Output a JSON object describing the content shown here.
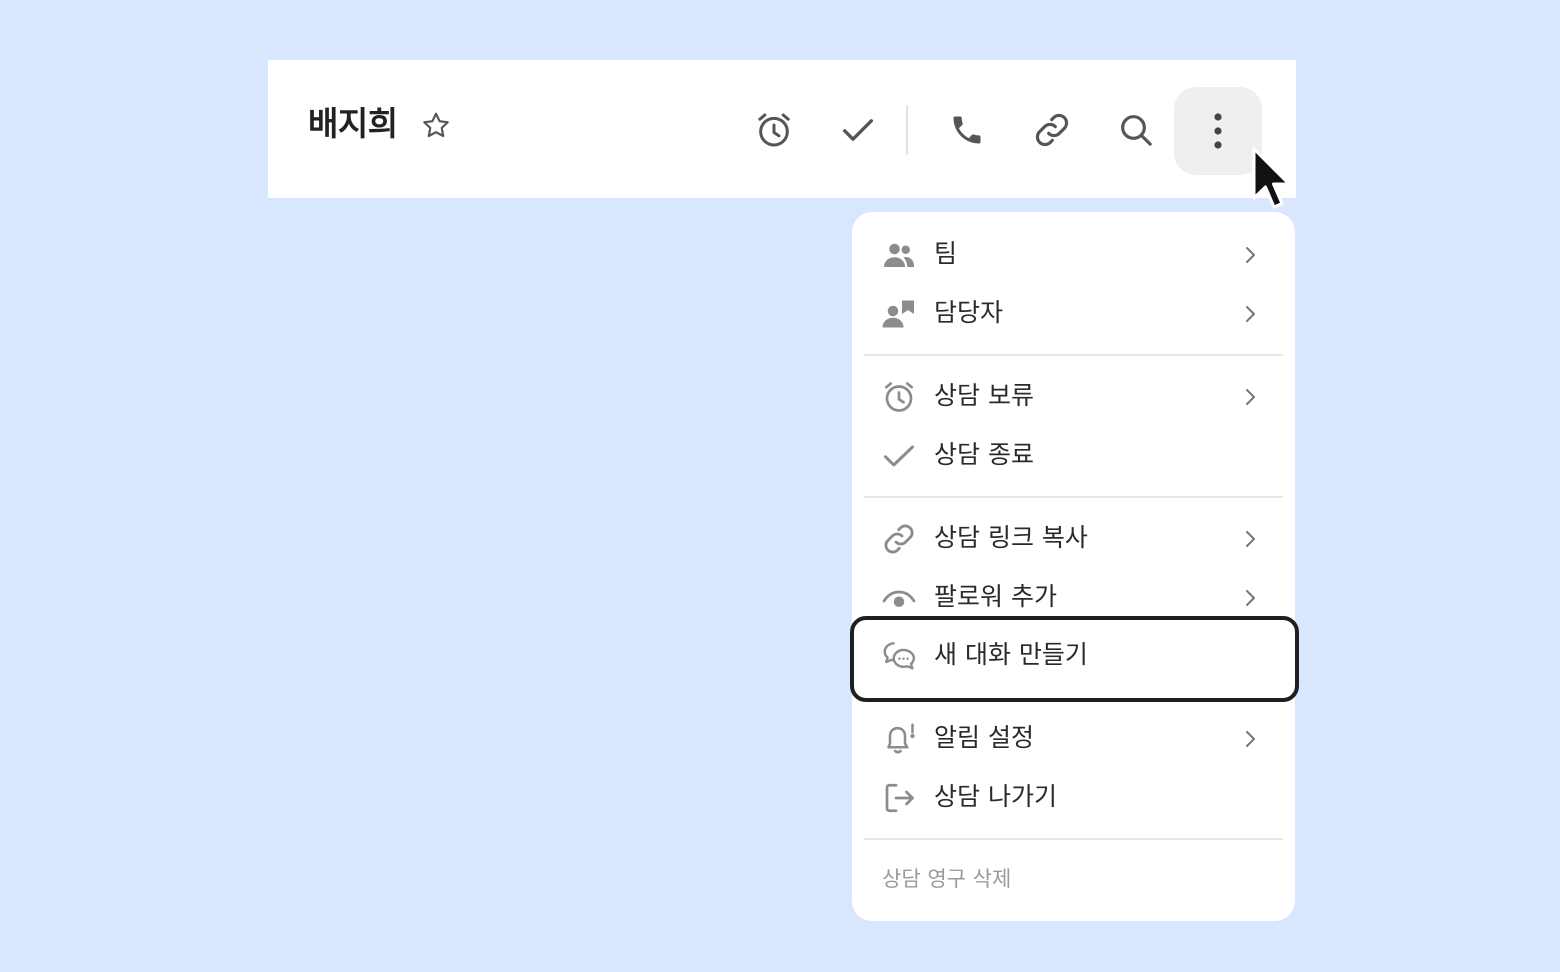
{
  "header": {
    "title": "배지희",
    "icons": [
      "star-icon",
      "alarm-clock-icon",
      "check-icon",
      "phone-icon",
      "link-icon",
      "search-icon",
      "more-vertical-icon"
    ]
  },
  "menu": {
    "items": [
      {
        "label": "팀",
        "icon": "team-icon",
        "has_submenu": true
      },
      {
        "label": "담당자",
        "icon": "assignee-icon",
        "has_submenu": true
      },
      {
        "label": "상담 보류",
        "icon": "alarm-clock-icon",
        "has_submenu": true
      },
      {
        "label": "상담 종료",
        "icon": "check-icon",
        "has_submenu": false
      },
      {
        "label": "상담 링크 복사",
        "icon": "link-icon",
        "has_submenu": true
      },
      {
        "label": "팔로워 추가",
        "icon": "eye-icon",
        "has_submenu": true
      },
      {
        "label": "새 대화 만들기",
        "icon": "chat-bubbles-icon",
        "has_submenu": false,
        "highlighted": true
      },
      {
        "label": "알림 설정",
        "icon": "bell-icon",
        "has_submenu": true
      },
      {
        "label": "상담 나가기",
        "icon": "exit-icon",
        "has_submenu": false
      }
    ],
    "danger_label": "상담 영구 삭제"
  },
  "colors": {
    "background": "#d8e6fe",
    "panel": "#ffffff",
    "icon": "#8c8c8c",
    "text": "#2a2a2a",
    "danger_text": "#9a9a9a",
    "highlight_border": "#1f1f1f"
  }
}
